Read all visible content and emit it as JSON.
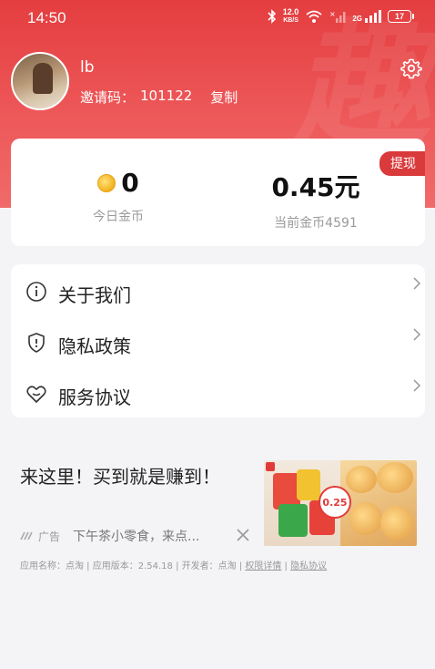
{
  "status_bar": {
    "time": "14:50",
    "net_speed_value": "12.0",
    "net_speed_unit": "KB/S",
    "signal_label": "2G",
    "battery": "17"
  },
  "profile": {
    "username": "lb",
    "invite_label": "邀请码：",
    "invite_code": "101122",
    "copy_label": "复制"
  },
  "watermark": "趣",
  "coins": {
    "today_value": "0",
    "today_label": "今日金币",
    "balance_value": "0.45元",
    "balance_label": "当前金币4591",
    "withdraw_label": "提现"
  },
  "menu": {
    "items": [
      {
        "label": "关于我们",
        "icon": "info-icon"
      },
      {
        "label": "隐私政策",
        "icon": "shield-icon"
      },
      {
        "label": "服务协议",
        "icon": "heart-icon"
      }
    ]
  },
  "ad": {
    "title": "来这里！买到就是赚到！",
    "tag": "广告",
    "description": "下午茶小零食，来点...",
    "price_badge": "0.25",
    "meta_text": "应用名称：点淘 | 应用版本：2.54.18 | 开发者：点淘 | ",
    "permissions_link": "权限详情",
    "privacy_link": "隐私协议"
  },
  "colors": {
    "header_red": "#e43d3f",
    "withdraw_red": "#d93a3b",
    "coin_gold": "#f5b82a"
  }
}
